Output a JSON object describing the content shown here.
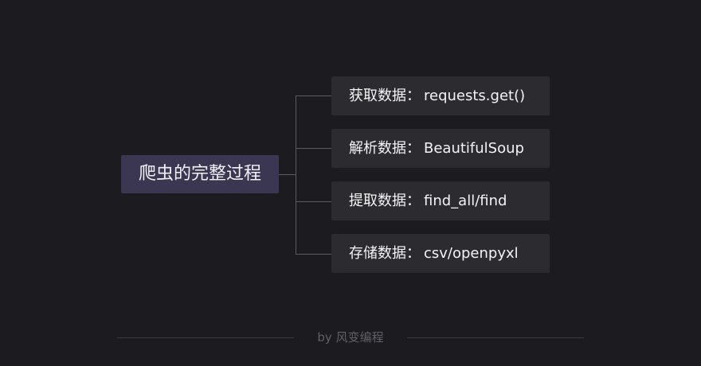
{
  "diagram": {
    "root": {
      "label": "爬虫的完整过程"
    },
    "branches": [
      {
        "prefix": "获取数据",
        "separator": "：",
        "value": "requests.get()"
      },
      {
        "prefix": "解析数据",
        "separator": "：",
        "value": "BeautifulSoup"
      },
      {
        "prefix": "提取数据",
        "separator": "：",
        "value": "find_all/find"
      },
      {
        "prefix": "存储数据",
        "separator": "：",
        "value": "csv/openpyxl"
      }
    ]
  },
  "footer": {
    "credit": "by 风变编程"
  },
  "colors": {
    "background": "#1c1b1f",
    "root_fill": "#3b3652",
    "branch_fill": "#2c2b30",
    "connector": "#5b5a60"
  }
}
